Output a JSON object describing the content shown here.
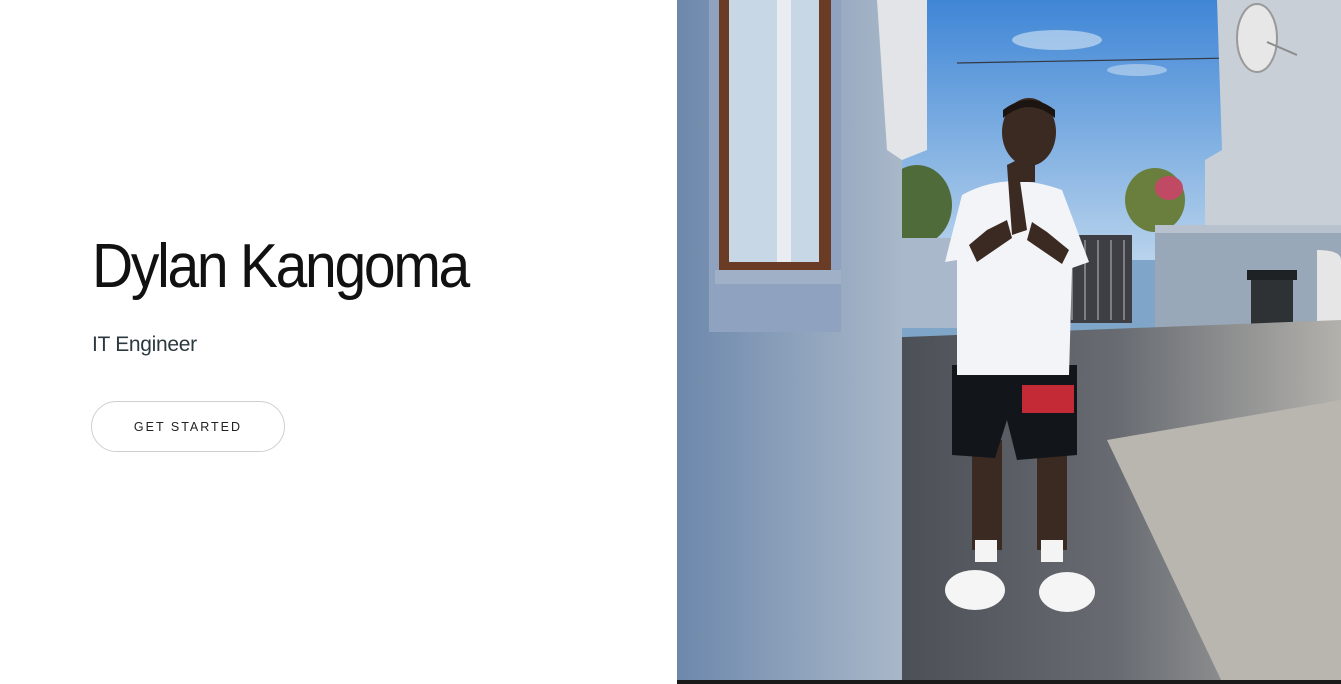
{
  "hero": {
    "title": "Dylan Kangoma",
    "subtitle": "IT Engineer",
    "button_label": "GET STARTED",
    "photo_alt": "Dylan Kangoma"
  },
  "colors": {
    "background": "#ffffff",
    "title": "#111111",
    "subtitle": "#2c3a3f",
    "button_border": "#cfcfcf",
    "sky": "#5f97d2",
    "wall": "#8ea3bb",
    "driveway": "#5b6068"
  }
}
